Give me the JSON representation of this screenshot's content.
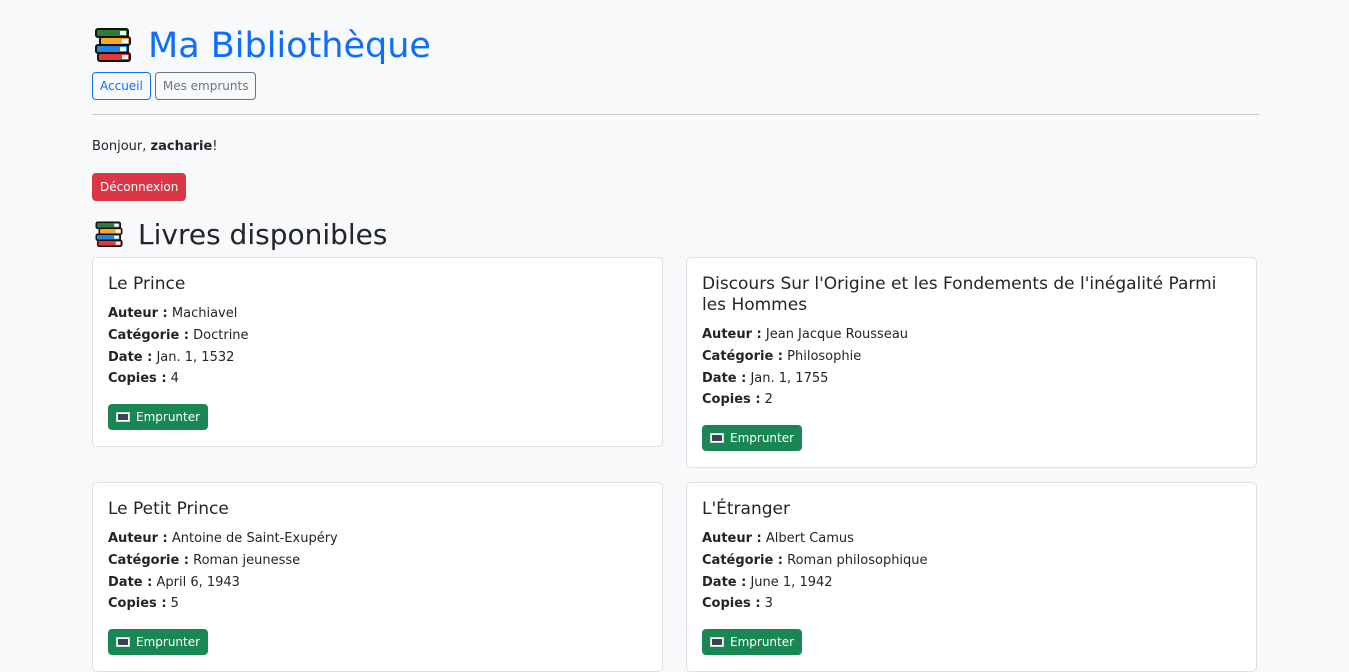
{
  "header": {
    "title": "Ma Bibliothèque",
    "logo_icon": "books-icon"
  },
  "nav": {
    "accueil": "Accueil",
    "emprunts": "Mes emprunts"
  },
  "greeting": {
    "prefix": "Bonjour, ",
    "username": "zacharie",
    "suffix": "!"
  },
  "logout_label": "Déconnexion",
  "section_title": "Livres disponibles",
  "labels": {
    "author": "Auteur :",
    "category": "Catégorie :",
    "date": "Date :",
    "copies": "Copies :",
    "borrow": "Emprunter"
  },
  "books": [
    {
      "title": "Le Prince",
      "author": "Machiavel",
      "category": "Doctrine",
      "date": "Jan. 1, 1532",
      "copies": "4"
    },
    {
      "title": "Discours Sur l'Origine et les Fondements de l'inégalité Parmi les Hommes",
      "author": "Jean Jacque Rousseau",
      "category": "Philosophie",
      "date": "Jan. 1, 1755",
      "copies": "2"
    },
    {
      "title": "Le Petit Prince",
      "author": "Antoine de Saint-Exupéry",
      "category": "Roman jeunesse",
      "date": "April 6, 1943",
      "copies": "5"
    },
    {
      "title": "L'Étranger",
      "author": "Albert Camus",
      "category": "Roman philosophique",
      "date": "June 1, 1942",
      "copies": "3"
    }
  ],
  "colors": {
    "primary": "#0d6efd",
    "danger": "#dc3545",
    "success": "#198754",
    "secondary": "#6c757d"
  }
}
